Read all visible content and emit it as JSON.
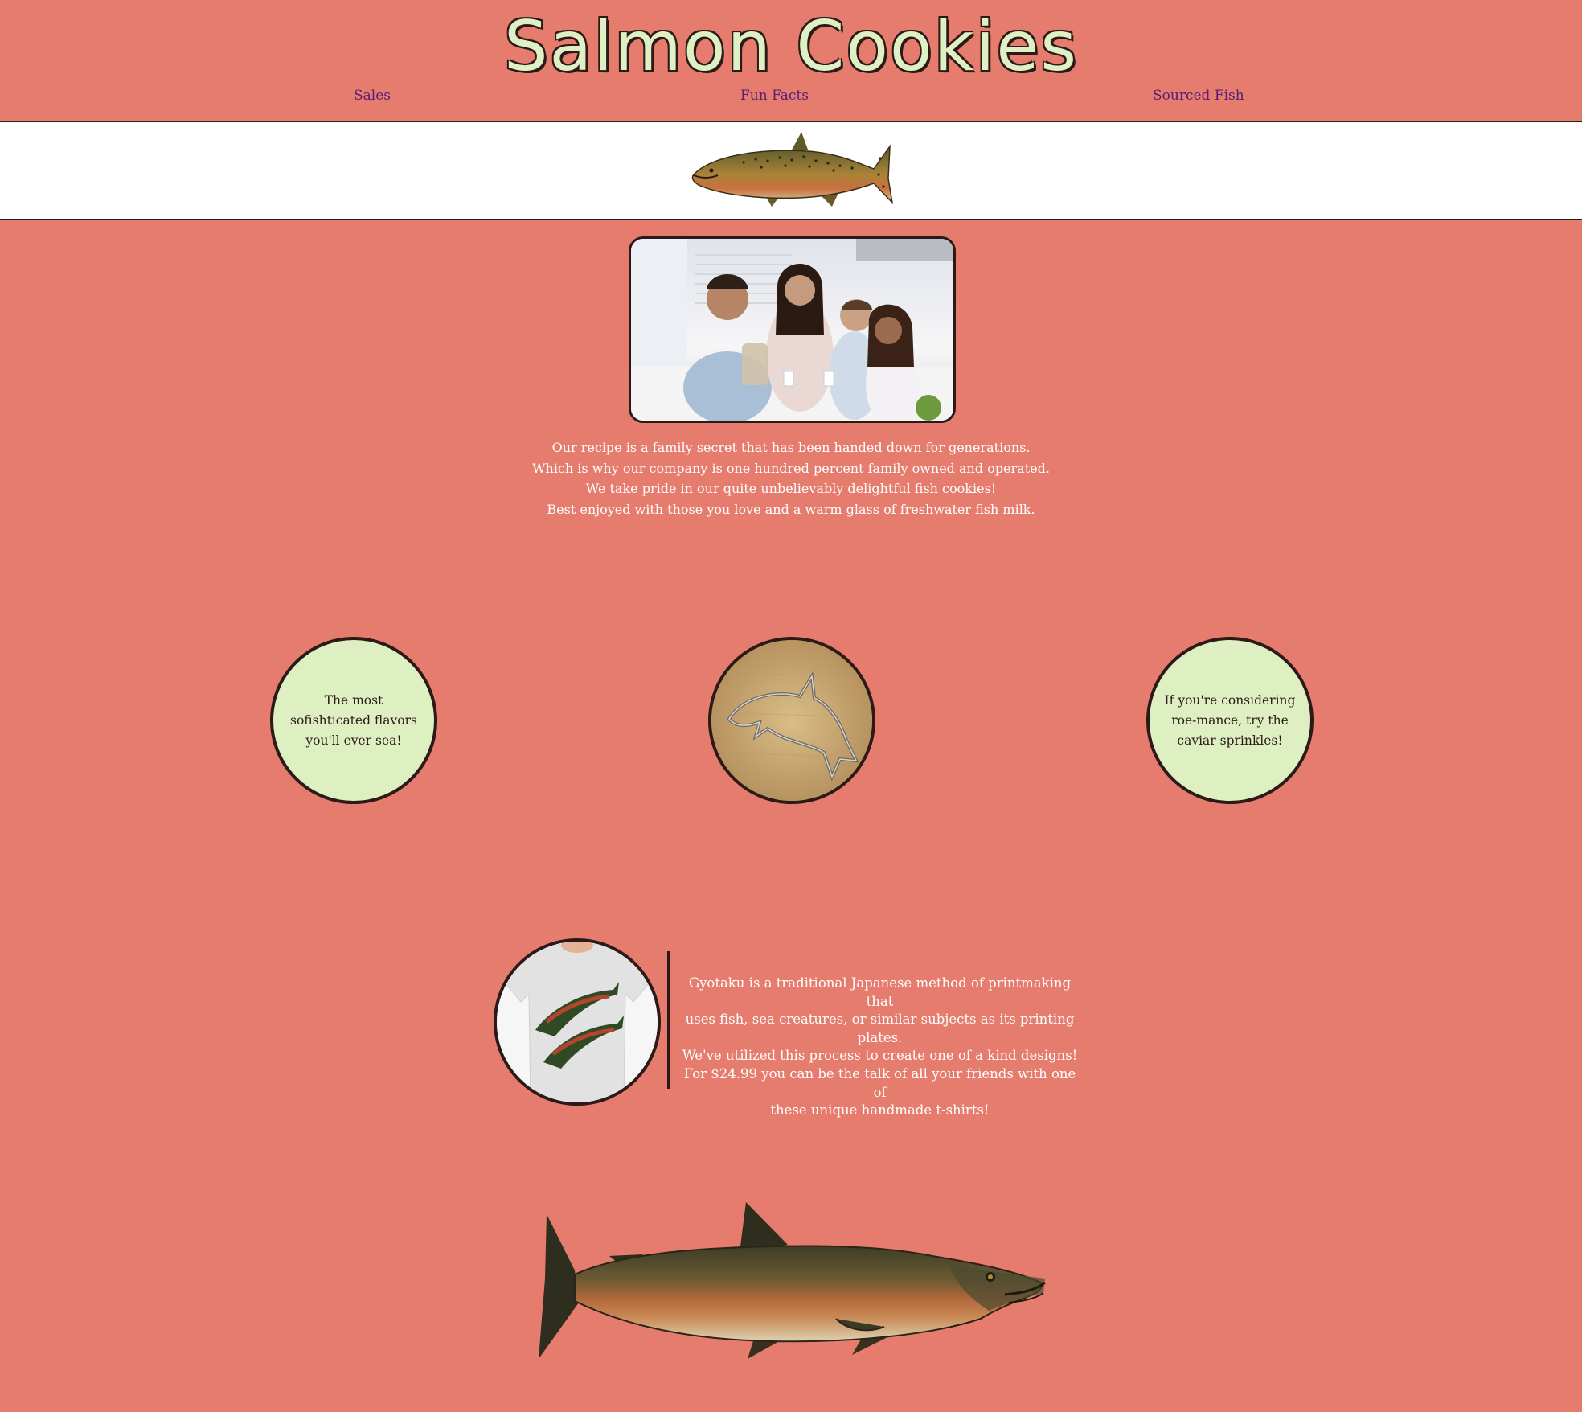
{
  "header": {
    "title": "Salmon Cookies"
  },
  "nav": {
    "items": [
      {
        "label": "Sales"
      },
      {
        "label": "Fun Facts"
      },
      {
        "label": "Sourced Fish"
      }
    ]
  },
  "intro": {
    "lines": [
      "Our recipe is a family secret that has been handed down for generations.",
      "Which is why our company is one hundred percent family owned and operated.",
      "We take pride in our quite unbelievably delightful fish cookies!",
      "Best enjoyed with those you love and a warm glass of freshwater fish milk."
    ]
  },
  "features": {
    "left": "The most sofishticated flavors you'll ever sea!",
    "right": "If you're considering roe-mance, try the caviar sprinkles!"
  },
  "gyotaku": {
    "lines": [
      "Gyotaku is a traditional Japanese method of printmaking that",
      "uses fish, sea creatures, or similar subjects as its printing plates.",
      "We've utilized this process to create one of a kind designs!",
      "For $24.99 you can be the talk of all your friends with one of",
      "these unique handmade t-shirts!"
    ]
  },
  "colors": {
    "background": "#e67c6d",
    "nav_link": "#5a1b75",
    "circle_fill": "#def0c2",
    "border": "#2b1a17",
    "title": "#dff1c4"
  },
  "icons": {
    "banner": "salmon-illustration",
    "feature_center": "fish-cookie-cutter",
    "tshirt": "gyotaku-tshirt",
    "footer": "large-salmon-illustration"
  }
}
